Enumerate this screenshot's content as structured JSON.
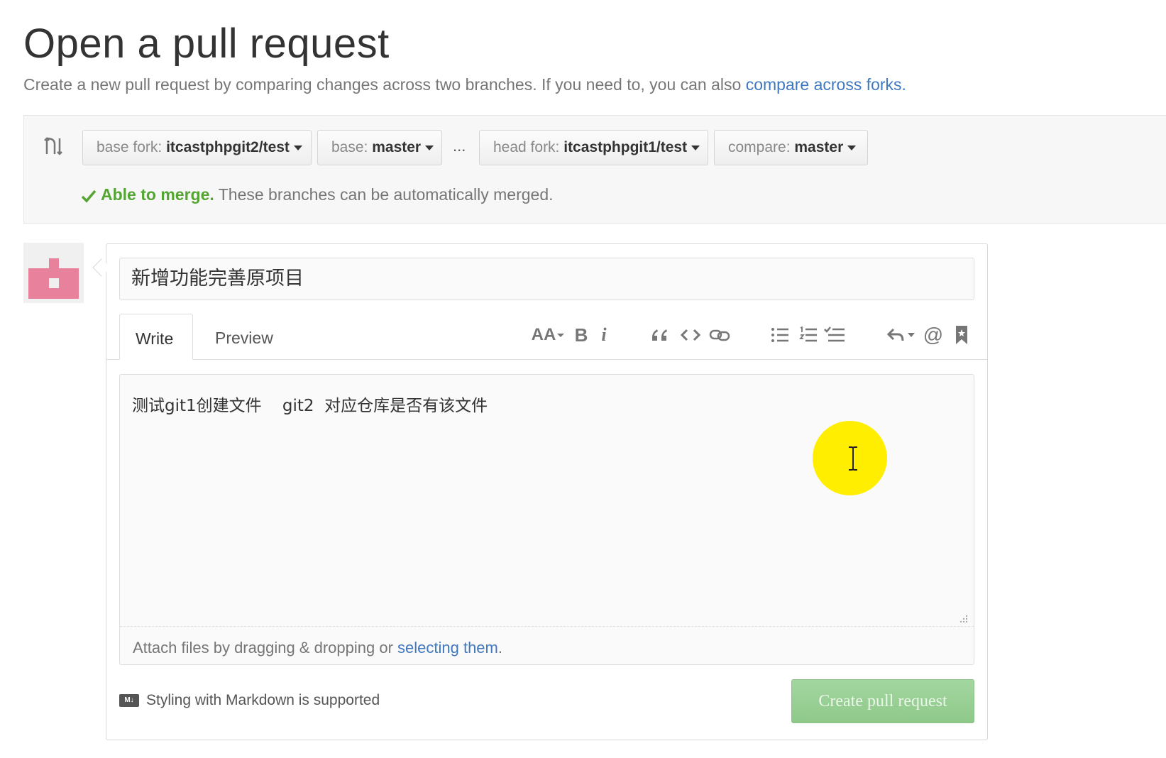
{
  "page": {
    "title": "Open a pull request",
    "subtitle_prefix": "Create a new pull request by comparing changes across two branches. If you need to, you can also ",
    "subtitle_link": "compare across forks."
  },
  "compare": {
    "base_fork_label": "base fork: ",
    "base_fork_value": "itcastphpgit2/test",
    "base_label": "base: ",
    "base_value": "master",
    "separator": "...",
    "head_fork_label": "head fork: ",
    "head_fork_value": "itcastphpgit1/test",
    "compare_label": "compare: ",
    "compare_value": "master",
    "merge_status": "Able to merge.",
    "merge_message": " These branches can be automatically merged.",
    "status_color": "#55a532"
  },
  "form": {
    "title_value": "新增功能完善原项目",
    "tabs": [
      "Write",
      "Preview"
    ],
    "active_tab": "Write",
    "body_value": "测试git1创建文件    git2  对应仓库是否有该文件",
    "attach_prefix": "Attach files by dragging & dropping or ",
    "attach_link": "selecting them",
    "attach_suffix": ".",
    "markdown_note": "Styling with Markdown is supported",
    "submit_label": "Create pull request",
    "toolbar": {
      "header": "AA",
      "bold": "B",
      "italic": "i",
      "at": "@"
    }
  },
  "colors": {
    "link": "#4078c0",
    "submit_bg": "#9fd39b",
    "cursor_highlight": "#ffee00"
  }
}
